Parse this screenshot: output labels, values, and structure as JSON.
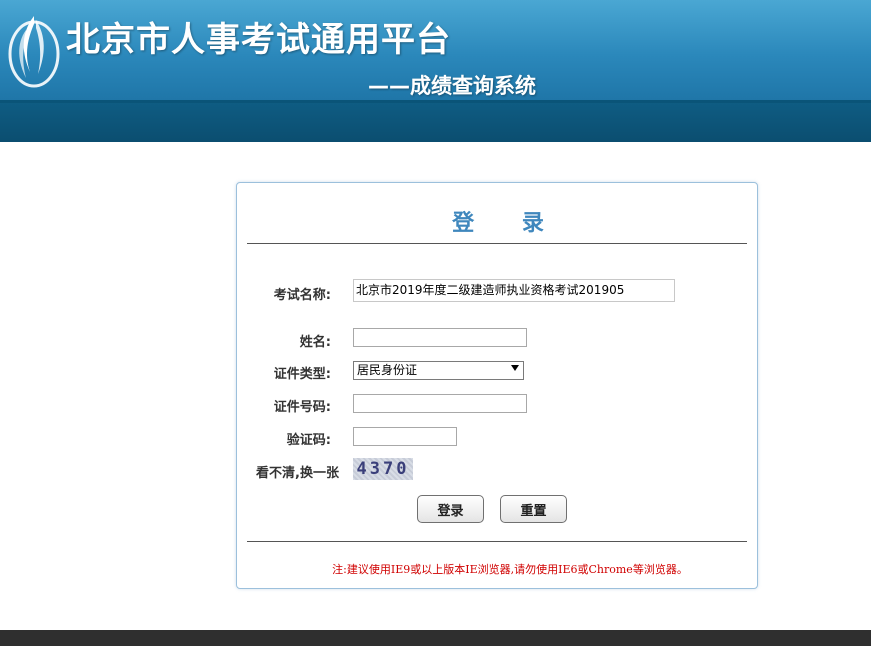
{
  "header": {
    "title": "北京市人事考试通用平台",
    "subtitle": "——成绩查询系统",
    "logo_icon": "flame-logo-icon"
  },
  "login": {
    "title": "登 录",
    "exam_label": "考试名称:",
    "exam_value": "北京市2019年度二级建造师执业资格考试201905",
    "name_label": "姓名:",
    "name_value": "",
    "id_type_label": "证件类型:",
    "id_type_value": "居民身份证",
    "id_number_label": "证件号码:",
    "id_number_value": "",
    "captcha_label": "验证码:",
    "captcha_value": "",
    "refresh_label": "看不清,换一张",
    "captcha_image_text": "4370",
    "login_button": "登录",
    "reset_button": "重置",
    "notice": "注:建议使用IE9或以上版本IE浏览器,请勿使用IE6或Chrome等浏览器。"
  },
  "colors": {
    "header_blue": "#2b88bb",
    "header_stripe": "#0b4e70",
    "title_blue": "#3f87bd",
    "notice_red": "#d00000"
  }
}
